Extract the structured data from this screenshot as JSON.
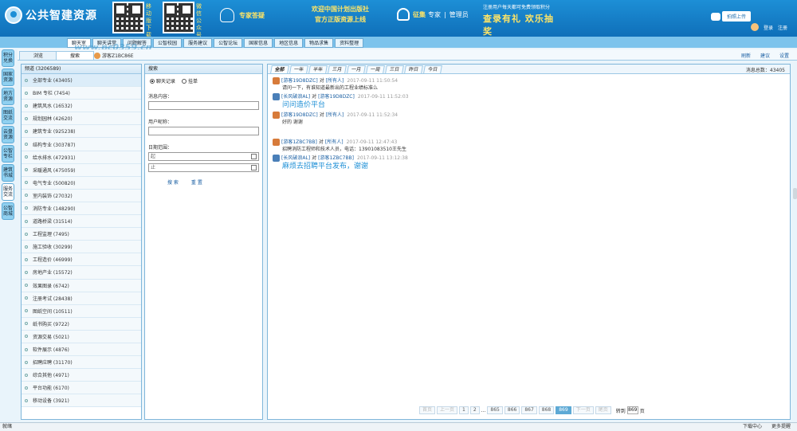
{
  "header": {
    "logo_text": "公共智建资源",
    "qr1_label": "移动版下载",
    "qr2_label": "微信公众号",
    "expert": "专家答疑",
    "welcome_line1": "欢迎中国计划出版社",
    "welcome_line2": "官方正版资源上线",
    "service_prefix": "征集",
    "service_expert": "专家",
    "service_sep": "|",
    "service_admin": "管理员",
    "promo_small": "注册用户每天都可免费领取积分",
    "promo_big": "查录有礼  欢乐抽奖",
    "notify_label": "拍照上传",
    "login": "登录",
    "register": "注册"
  },
  "nav": {
    "tabs": [
      "聊天室",
      "聊天讲堂",
      "问题解答",
      "公智校园",
      "服务建议",
      "公智论坛",
      "国家信息",
      "地区信息",
      "物品求售",
      "资料整理"
    ]
  },
  "watermark": "www.pc0359.cn",
  "subbar": {
    "tab_browse": "浏览",
    "tab_search": "搜索",
    "user": "游客Z1BC86E",
    "links": [
      "刷新",
      "建议",
      "设置"
    ]
  },
  "vtabs": [
    "积分兑换",
    "国家资源",
    "地方资源",
    "图纸交流",
    "云盘资源",
    "公智专栏",
    "建筑书城",
    "服务交流",
    "公智商城"
  ],
  "categories": {
    "title": "频道 (3206589)",
    "items": [
      "全部专业 (43405)",
      "BIM 专栏 (7454)",
      "建筑风水 (16532)",
      "规划园林 (42620)",
      "建筑专业 (925238)",
      "结构专业 (303787)",
      "给水排水 (472931)",
      "采暖通风 (475059)",
      "电气专业 (500820)",
      "室内装饰 (27032)",
      "消防专业 (148290)",
      "道路桥梁 (31514)",
      "工程监理 (7495)",
      "施工验收 (30299)",
      "工程造价 (46999)",
      "房地产业 (15572)",
      "效果图录 (6742)",
      "注册考试 (28438)",
      "图纸空间 (10511)",
      "纸书购买 (9722)",
      "资源交易 (5021)",
      "软件展示 (4876)",
      "招聘应聘 (31170)",
      "综合其他 (4971)",
      "平台功能 (6170)",
      "移动设备 (3921)"
    ]
  },
  "search": {
    "title": "搜索",
    "radio1": "聊天记录",
    "radio2": "挂单",
    "content_label": "消息内容：",
    "nickname_label": "用户昵称：",
    "date_label": "日期范围：",
    "from_placeholder": "起",
    "to_placeholder": "止",
    "search_btn": "搜 索",
    "reset_btn": "重 置"
  },
  "chat": {
    "tabs": [
      "全部",
      "一年",
      "半年",
      "三月",
      "一月",
      "一周",
      "三日",
      "昨日",
      "今日"
    ],
    "total": "消息总数：43405",
    "messages": [
      {
        "from": "[游客19D8DZC]",
        "to_word": "对",
        "target": "[所有人]",
        "time": "2017-09-11 11:50:54",
        "body": "请问一下，有谁知道最新出的工程业绩标准么",
        "big": false,
        "avatar": "orange"
      },
      {
        "from": "[长风破浪AL]",
        "to_word": "对",
        "target": "[游客19D8DZC]",
        "time": "2017-09-11 11:52:03",
        "body": "问问造价平台",
        "big": true,
        "avatar": "blue"
      },
      {
        "from": "[游客19D8DZC]",
        "to_word": "对",
        "target": "[所有人]",
        "time": "2017-09-11 11:52:34",
        "body": "好的  谢谢",
        "big": false,
        "avatar": "orange"
      },
      {
        "from": "[游客1ZBC7BB]",
        "to_word": "对",
        "target": "[所有人]",
        "time": "2017-09-11 12:47:43",
        "body": "招聘消防工程师和技术人员，电话：13901083510王先生",
        "big": false,
        "avatar": "orange",
        "gap": true
      },
      {
        "from": "[长风破浪AL]",
        "to_word": "对",
        "target": "[游客1ZBC7BB]",
        "time": "2017-09-11 13:12:38",
        "body": "麻烦去招聘平台发布，谢谢",
        "big": true,
        "avatar": "blue"
      }
    ],
    "pager": {
      "first": "首页",
      "prev": "上一页",
      "p1": "1",
      "p2": "2",
      "ellipsis": "...",
      "p865": "865",
      "p866": "866",
      "p867": "867",
      "p868": "868",
      "p869": "869",
      "next": "下一页",
      "last": "尾页",
      "goto": "转到",
      "goto_val": "869",
      "page": "页"
    }
  },
  "status": {
    "left": "就绪",
    "download": "下载中心",
    "more": "更多提醒"
  }
}
